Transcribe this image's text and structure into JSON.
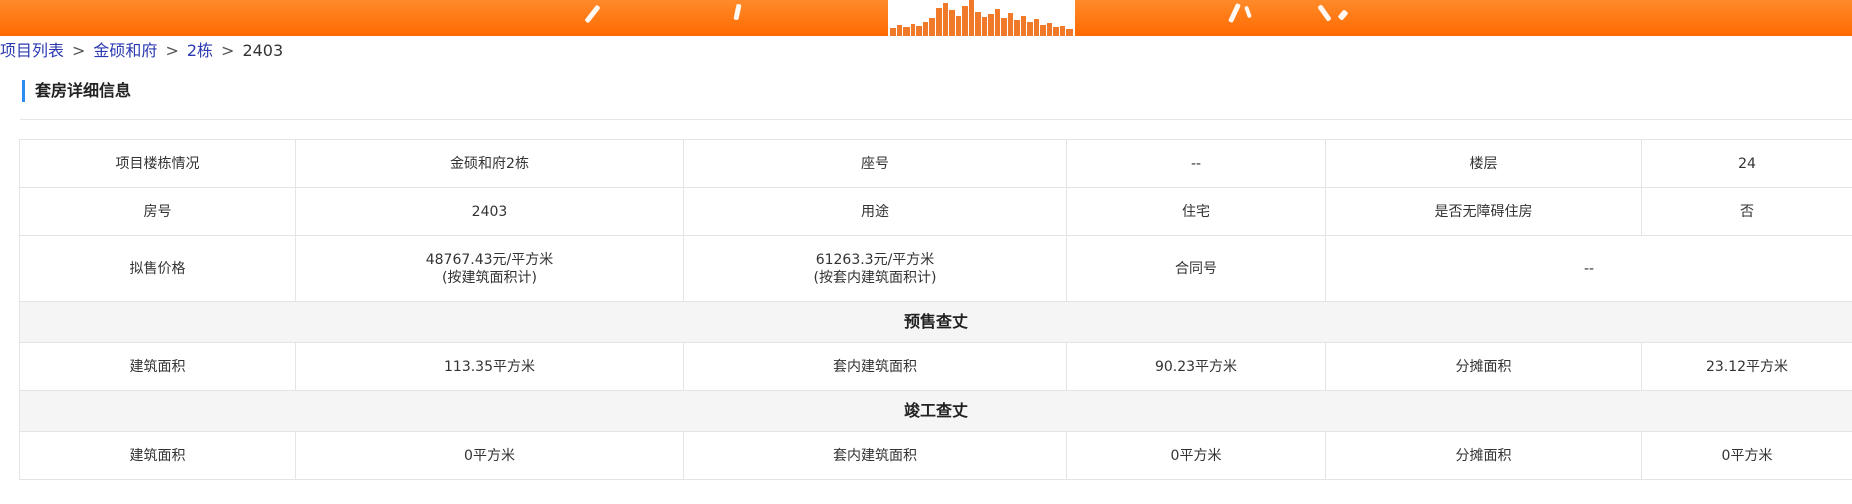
{
  "breadcrumb": {
    "items": [
      "项目列表",
      "金硕和府",
      "2栋"
    ],
    "current": "2403",
    "separator": ">"
  },
  "section_title": "套房详细信息",
  "details": {
    "building_label": "项目楼栋情况",
    "building_value": "金硕和府2栋",
    "seat_label": "座号",
    "seat_value": "--",
    "floor_label": "楼层",
    "floor_value": "24",
    "room_label": "房号",
    "room_value": "2403",
    "usage_label": "用途",
    "usage_value": "住宅",
    "accessible_label": "是否无障碍住房",
    "accessible_value": "否",
    "price_label": "拟售价格",
    "price_building_value": "48767.43元/平方米",
    "price_building_note": "(按建筑面积计)",
    "price_inner_value": "61263.3元/平方米",
    "price_inner_note": "(按套内建筑面积计)",
    "contract_label": "合同号",
    "contract_value": "--"
  },
  "presale": {
    "title": "预售查丈",
    "area_label": "建筑面积",
    "area_value": "113.35平方米",
    "inner_label": "套内建筑面积",
    "inner_value": "90.23平方米",
    "shared_label": "分摊面积",
    "shared_value": "23.12平方米"
  },
  "completion": {
    "title": "竣工查丈",
    "area_label": "建筑面积",
    "area_value": "0平方米",
    "inner_label": "套内建筑面积",
    "inner_value": "0平方米",
    "shared_label": "分摊面积",
    "shared_value": "0平方米"
  },
  "colors": {
    "banner": "#ff6a00",
    "link": "#2b3ab0",
    "title_accent": "#2d8cf0",
    "group_row_bg": "#f5f5f5"
  }
}
